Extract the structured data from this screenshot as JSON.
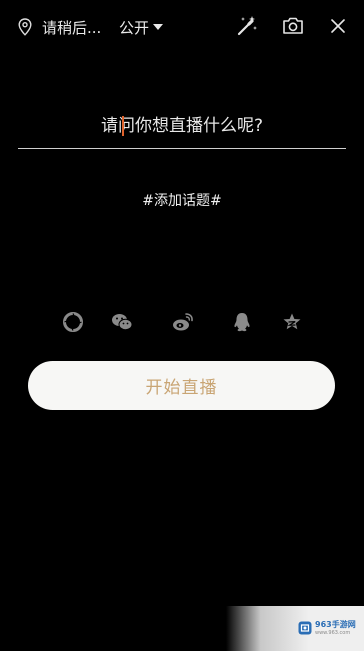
{
  "topbar": {
    "location_label": "请稍后...",
    "privacy_label": "公开",
    "icons": {
      "location": "location-pin-icon",
      "privacy_dropdown": "caret-down-icon",
      "beauty": "magic-wand-icon",
      "camera": "camera-flip-icon",
      "close": "close-icon"
    }
  },
  "title_input": {
    "placeholder": "请问你想直播什么呢?",
    "value": ""
  },
  "topic": {
    "label": "#添加话题#"
  },
  "share": {
    "items": [
      {
        "name": "moments",
        "icon": "wechat-moments-icon"
      },
      {
        "name": "wechat",
        "icon": "wechat-icon"
      },
      {
        "name": "weibo",
        "icon": "weibo-icon"
      },
      {
        "name": "qq",
        "icon": "qq-icon"
      },
      {
        "name": "qzone",
        "icon": "qzone-star-icon"
      }
    ]
  },
  "start_button": {
    "label": "开始直播"
  },
  "watermark": {
    "brand": "963手游网",
    "url": "www.963.com"
  },
  "colors": {
    "background": "#000000",
    "cursor": "#e0632c",
    "start_text": "#c9a574",
    "start_bg": "#f7f7f5",
    "icon_gray": "#8a8a8a"
  }
}
